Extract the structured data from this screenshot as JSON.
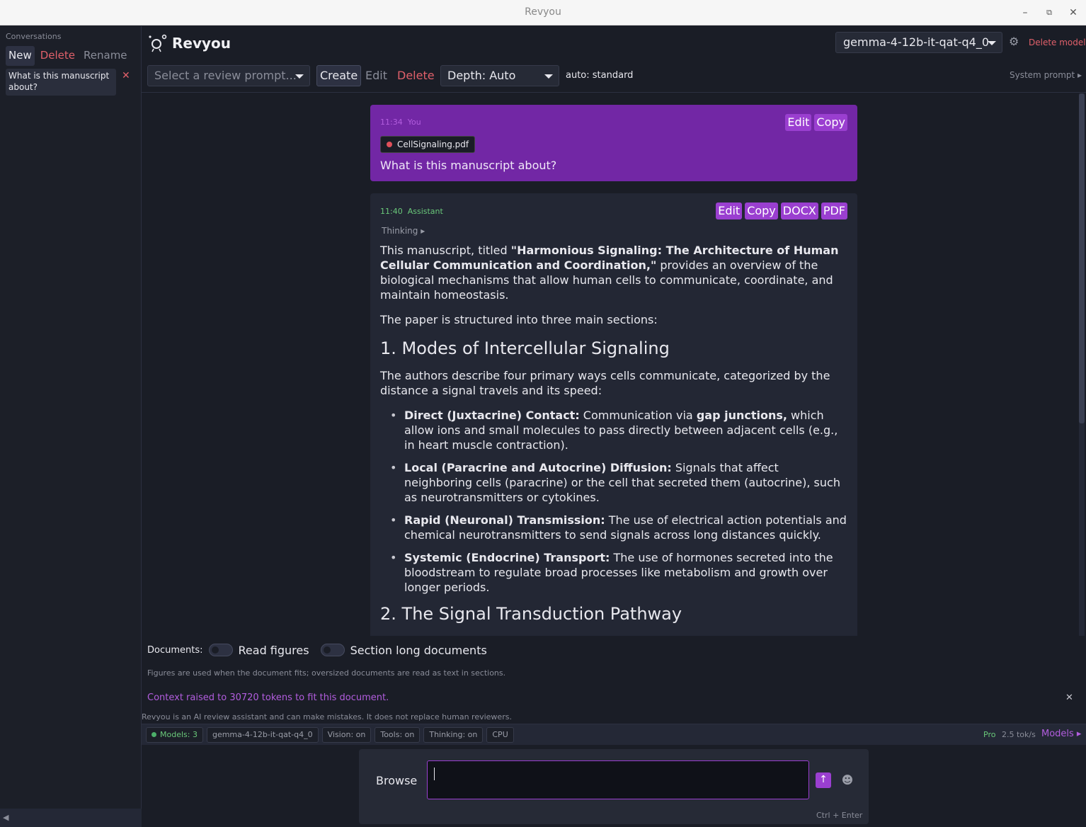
{
  "window": {
    "title": "Revyou"
  },
  "sidebar": {
    "heading": "Conversations",
    "new_label": "New",
    "delete_label": "Delete",
    "rename_label": "Rename",
    "conversations": [
      {
        "title": "What is this manuscript about?"
      }
    ]
  },
  "header": {
    "app_name": "Revyou",
    "model": "gemma-4-12b-it-qat-q4_0",
    "delete_model_label": "Delete model",
    "prompt_placeholder": "Select a review prompt...",
    "create_label": "Create",
    "edit_label": "Edit",
    "delete_label": "Delete",
    "depth": "Depth: Auto",
    "auto_note": "auto: standard",
    "system_prompt_label": "System prompt ▸"
  },
  "messages": {
    "user": {
      "time": "11:34",
      "author": "You",
      "attachment": "CellSignaling.pdf",
      "text": "What is this manuscript about?",
      "actions": [
        "Edit",
        "Copy"
      ]
    },
    "assistant": {
      "time": "11:40",
      "author": "Assistant",
      "thinking_label": "Thinking ▸",
      "actions": [
        "Edit",
        "Copy",
        "DOCX",
        "PDF"
      ],
      "intro_a": "This manuscript, titled ",
      "intro_title": "\"Harmonious Signaling: The Architecture of Human Cellular Communication and Coordination,\"",
      "intro_b": " provides an overview of the biological mechanisms that allow human cells to communicate, coordinate, and maintain homeostasis.",
      "structure": "The paper is structured into three main sections:",
      "section1_heading": "1. Modes of Intercellular Signaling",
      "section1_intro": "The authors describe four primary ways cells communicate, categorized by the distance a signal travels and its speed:",
      "bullets": [
        {
          "label": "Direct (Juxtacrine) Contact:",
          "text_a": " Communication via ",
          "bold_mid": "gap junctions,",
          "text_b": " which allow ions and small molecules to pass directly between adjacent cells (e.g., in heart muscle contraction)."
        },
        {
          "label": "Local (Paracrine and Autocrine) Diffusion:",
          "text_a": " Signals that affect neighboring cells (paracrine) or the cell that secreted them (autocrine), such as neurotransmitters or cytokines.",
          "bold_mid": "",
          "text_b": ""
        },
        {
          "label": "Rapid (Neuronal) Transmission:",
          "text_a": " The use of electrical action potentials and chemical neurotransmitters to send signals across long distances quickly.",
          "bold_mid": "",
          "text_b": ""
        },
        {
          "label": "Systemic (Endocrine) Transport:",
          "text_a": " The use of hormones secreted into the bloodstream to regulate broad processes like metabolism and growth over longer periods.",
          "bold_mid": "",
          "text_b": ""
        }
      ],
      "section2_heading": "2. The Signal Transduction Pathway"
    }
  },
  "documents": {
    "label": "Documents:",
    "read_figures_label": "Read figures",
    "section_long_label": "Section long documents",
    "note": "Figures are used when the document fits; oversized documents are read as text in sections."
  },
  "context_note": "Context raised to 30720 tokens to fit this document.",
  "disclaimer": "Revyou is an AI review assistant and can make mistakes. It does not replace human reviewers.",
  "statusbar": {
    "models_count": "Models: 3",
    "model": "gemma-4-12b-it-qat-q4_0",
    "vision": "Vision: on",
    "tools": "Tools: on",
    "thinking": "Thinking: on",
    "device": "CPU",
    "tier": "Pro",
    "speed": "2.5 tok/s",
    "models_link": "Models ▸"
  },
  "composer": {
    "browse_label": "Browse",
    "shortcut": "Ctrl + Enter"
  },
  "colors": {
    "accent": "#9a3fd0",
    "user_bubble": "#7227a5",
    "danger": "#e0606a",
    "success": "#6ac97a"
  }
}
